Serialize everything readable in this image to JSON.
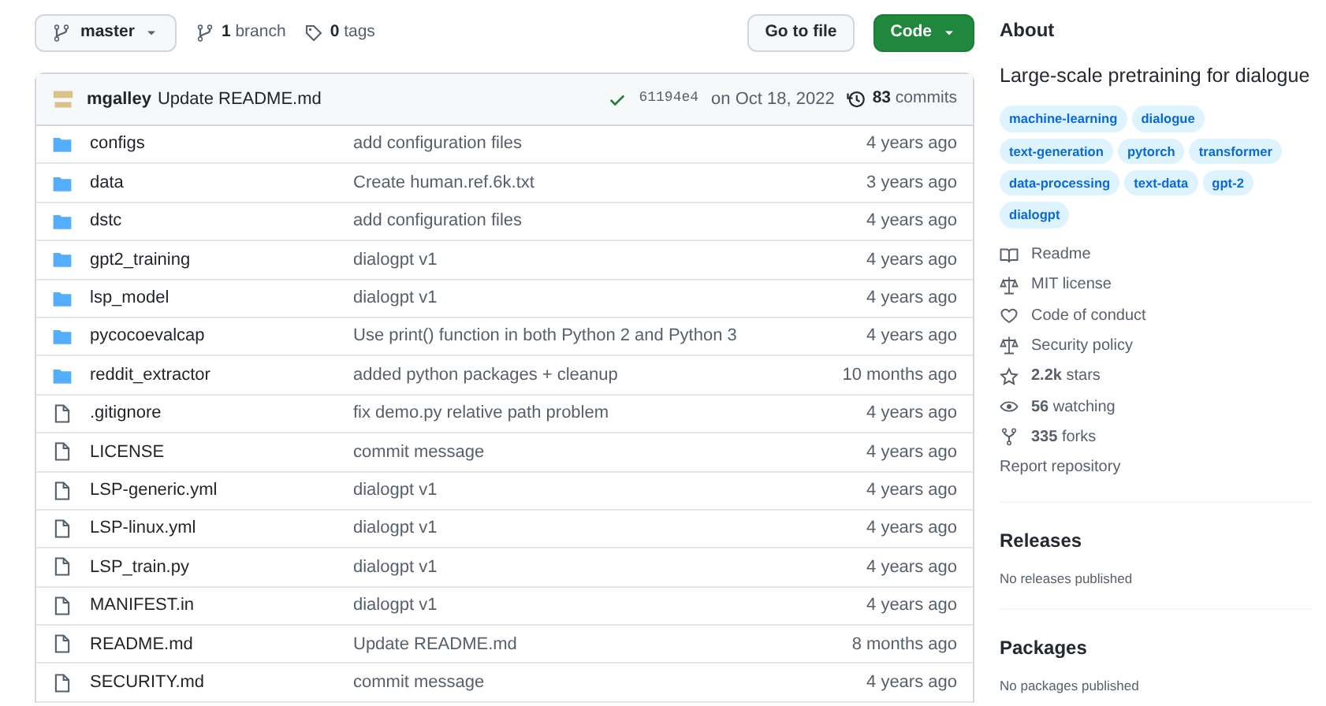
{
  "branch_selector": {
    "label": "master"
  },
  "branch_count": "**1** branch",
  "tag_count": "**0** tags",
  "buttons": [
    {
      "label": "Go to file",
      "kind": "secondary"
    },
    {
      "label": "Code",
      "kind": "primary"
    }
  ],
  "latest_commit": {
    "author": "mgalley",
    "message": "Update README.md",
    "hash": "61194e4",
    "date": "on Oct 18, 2022",
    "commits": "**83** commits"
  },
  "files": [
    {
      "kind": "folder",
      "name": "configs",
      "message": "add configuration files",
      "age": "4 years ago"
    },
    {
      "kind": "folder",
      "name": "data",
      "message": "Create human.ref.6k.txt",
      "age": "3 years ago"
    },
    {
      "kind": "folder",
      "name": "dstc",
      "message": "add configuration files",
      "age": "4 years ago"
    },
    {
      "kind": "folder",
      "name": "gpt2_training",
      "message": "dialogpt v1",
      "age": "4 years ago"
    },
    {
      "kind": "folder",
      "name": "lsp_model",
      "message": "dialogpt v1",
      "age": "4 years ago"
    },
    {
      "kind": "folder",
      "name": "pycocoevalcap",
      "message": "Use print() function in both Python 2 and Python 3",
      "age": "4 years ago"
    },
    {
      "kind": "folder",
      "name": "reddit_extractor",
      "message": "added python packages + cleanup",
      "age": "10 months ago"
    },
    {
      "kind": "file",
      "name": ".gitignore",
      "message": "fix demo.py relative path problem",
      "age": "4 years ago"
    },
    {
      "kind": "file",
      "name": "LICENSE",
      "message": "commit message",
      "age": "4 years ago"
    },
    {
      "kind": "file",
      "name": "LSP-generic.yml",
      "message": "dialogpt v1",
      "age": "4 years ago"
    },
    {
      "kind": "file",
      "name": "LSP-linux.yml",
      "message": "dialogpt v1",
      "age": "4 years ago"
    },
    {
      "kind": "file",
      "name": "LSP_train.py",
      "message": "dialogpt v1",
      "age": "4 years ago"
    },
    {
      "kind": "file",
      "name": "MANIFEST.in",
      "message": "dialogpt v1",
      "age": "4 years ago"
    },
    {
      "kind": "file",
      "name": "README.md",
      "message": "Update README.md",
      "age": "8 months ago"
    },
    {
      "kind": "file",
      "name": "SECURITY.md",
      "message": "commit message",
      "age": "4 years ago"
    }
  ],
  "about": {
    "title": "About",
    "description": "Large-scale pretraining for dialogue",
    "topics": [
      "machine-learning",
      "dialogue",
      "text-generation",
      "pytorch",
      "transformer",
      "data-processing",
      "text-data",
      "gpt-2",
      "dialogpt"
    ],
    "links": [
      {
        "kind": "book",
        "text": "Readme"
      },
      {
        "kind": "scale",
        "text": "MIT license"
      },
      {
        "kind": "heart",
        "text": "Code of conduct"
      },
      {
        "kind": "scale",
        "text": "Security policy"
      },
      {
        "kind": "star",
        "text": "**2.2k** stars"
      },
      {
        "kind": "eye",
        "text": "**56** watching"
      },
      {
        "kind": "fork",
        "text": "**335** forks"
      }
    ],
    "report": "Report repository"
  },
  "releases": {
    "title": "Releases",
    "note": "No releases published"
  },
  "packages": {
    "title": "Packages",
    "note": "No packages published"
  }
}
